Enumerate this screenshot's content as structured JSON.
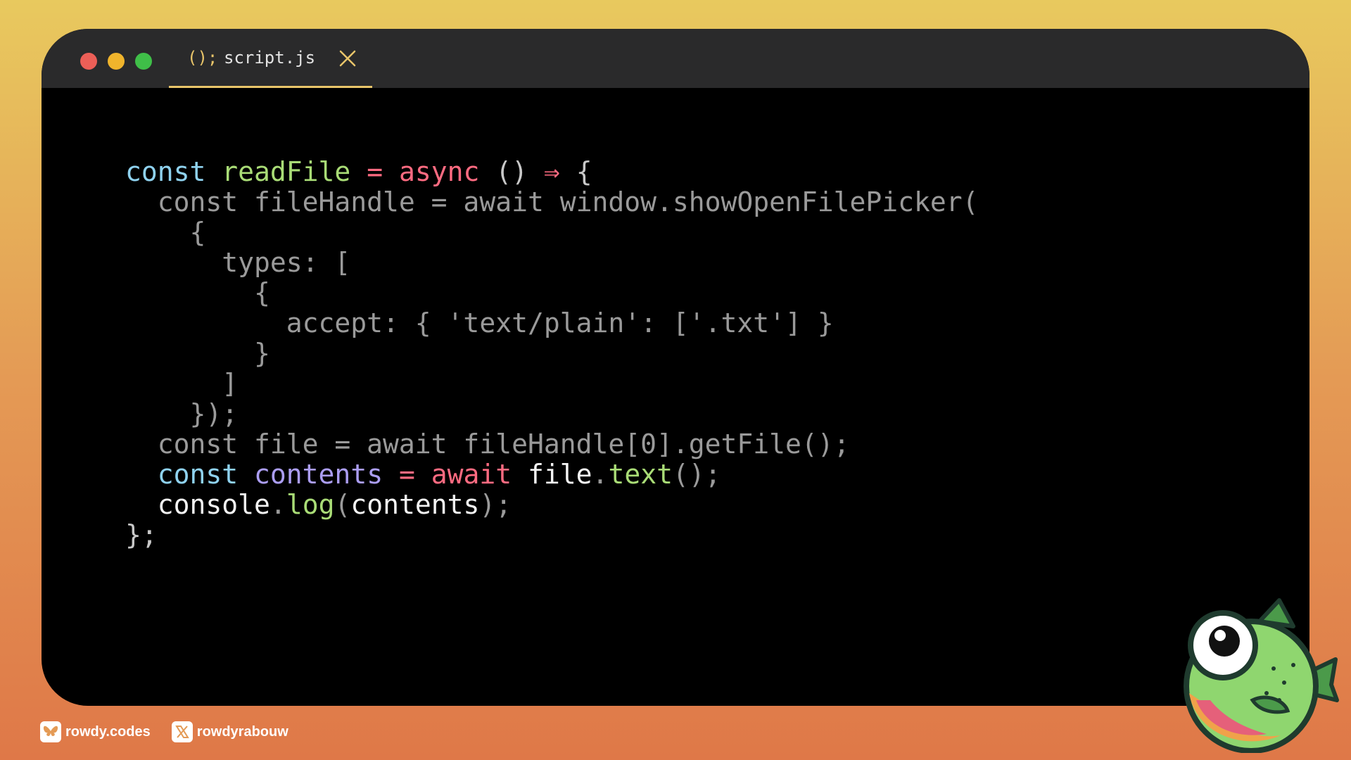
{
  "tab": {
    "icon_text": "();",
    "filename": "script.js"
  },
  "code_lines": [
    [
      {
        "t": "const",
        "c": "c-blue"
      },
      {
        "t": " ",
        "c": ""
      },
      {
        "t": "readFile",
        "c": "c-green"
      },
      {
        "t": " ",
        "c": ""
      },
      {
        "t": "=",
        "c": "c-pink"
      },
      {
        "t": " ",
        "c": ""
      },
      {
        "t": "async",
        "c": "c-pink"
      },
      {
        "t": " ",
        "c": ""
      },
      {
        "t": "()",
        "c": "c-lgray"
      },
      {
        "t": " ",
        "c": ""
      },
      {
        "t": "⇒",
        "c": "c-pink"
      },
      {
        "t": " ",
        "c": ""
      },
      {
        "t": "{",
        "c": "c-lgray"
      }
    ],
    [
      {
        "t": "  const fileHandle = await window.showOpenFilePicker(",
        "c": "c-gray"
      }
    ],
    [
      {
        "t": "    {",
        "c": "c-gray"
      }
    ],
    [
      {
        "t": "      types: [",
        "c": "c-gray"
      }
    ],
    [
      {
        "t": "        {",
        "c": "c-gray"
      }
    ],
    [
      {
        "t": "          accept: { 'text/plain': ['.txt'] }",
        "c": "c-gray"
      }
    ],
    [
      {
        "t": "        }",
        "c": "c-gray"
      }
    ],
    [
      {
        "t": "      ]",
        "c": "c-gray"
      }
    ],
    [
      {
        "t": "    });",
        "c": "c-gray"
      }
    ],
    [
      {
        "t": "  const file = await fileHandle[0].getFile();",
        "c": "c-gray"
      }
    ],
    [
      {
        "t": "  ",
        "c": ""
      },
      {
        "t": "const",
        "c": "c-blue"
      },
      {
        "t": " ",
        "c": ""
      },
      {
        "t": "contents",
        "c": "c-purple"
      },
      {
        "t": " ",
        "c": ""
      },
      {
        "t": "=",
        "c": "c-pink"
      },
      {
        "t": " ",
        "c": ""
      },
      {
        "t": "await",
        "c": "c-pink"
      },
      {
        "t": " ",
        "c": ""
      },
      {
        "t": "file",
        "c": "c-white"
      },
      {
        "t": ".",
        "c": "c-gray"
      },
      {
        "t": "text",
        "c": "c-green"
      },
      {
        "t": "();",
        "c": "c-gray"
      }
    ],
    [
      {
        "t": "  ",
        "c": ""
      },
      {
        "t": "console",
        "c": "c-white"
      },
      {
        "t": ".",
        "c": "c-gray"
      },
      {
        "t": "log",
        "c": "c-green"
      },
      {
        "t": "(",
        "c": "c-gray"
      },
      {
        "t": "contents",
        "c": "c-white"
      },
      {
        "t": ");",
        "c": "c-gray"
      }
    ],
    [
      {
        "t": "};",
        "c": "c-lgray"
      }
    ]
  ],
  "footer": {
    "bluesky_handle": "rowdy.codes",
    "x_handle": "rowdyrabouw"
  },
  "colors": {
    "accent": "#e9c56a",
    "keyword": "#8fd2ef",
    "function": "#a9dc76",
    "operator": "#ff6b81",
    "variable": "#ab9df2"
  },
  "icons": {
    "close": "close-icon",
    "bluesky": "bluesky-icon",
    "x": "x-logo-icon",
    "mascot": "fish-mascot"
  }
}
